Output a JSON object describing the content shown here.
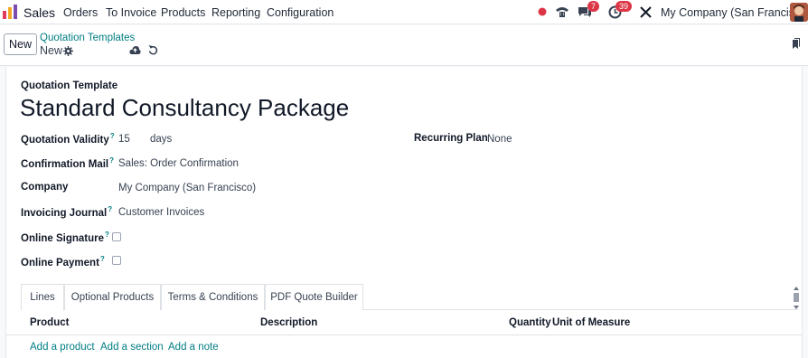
{
  "navbar": {
    "app_name": "Sales",
    "menu": [
      {
        "label": "Orders"
      },
      {
        "label": "To Invoice"
      },
      {
        "label": "Products"
      },
      {
        "label": "Reporting"
      },
      {
        "label": "Configuration"
      }
    ],
    "messages_badge": "7",
    "activities_badge": "39",
    "company": "My Company (San Francisco)"
  },
  "control": {
    "new_label": "New",
    "breadcrumb": "Quotation Templates",
    "current": "New"
  },
  "form": {
    "section_label": "Quotation Template",
    "title": "Standard Consultancy Package",
    "fields": {
      "validity_label": "Quotation Validity",
      "validity_value": "15",
      "validity_unit": "days",
      "mail_label": "Confirmation Mail",
      "mail_value": "Sales: Order Confirmation",
      "company_label": "Company",
      "company_value": "My Company (San Francisco)",
      "journal_label": "Invoicing Journal",
      "journal_value": "Customer Invoices",
      "signature_label": "Online Signature",
      "payment_label": "Online Payment",
      "recurring_label": "Recurring Plan",
      "recurring_value": "None",
      "help_mark": "?"
    }
  },
  "tabs": [
    {
      "label": "Lines"
    },
    {
      "label": "Optional Products"
    },
    {
      "label": "Terms & Conditions"
    },
    {
      "label": "PDF Quote Builder"
    }
  ],
  "table": {
    "columns": [
      "Product",
      "Description",
      "Quantity",
      "Unit of Measure"
    ],
    "actions": [
      "Add a product",
      "Add a section",
      "Add a note"
    ]
  }
}
